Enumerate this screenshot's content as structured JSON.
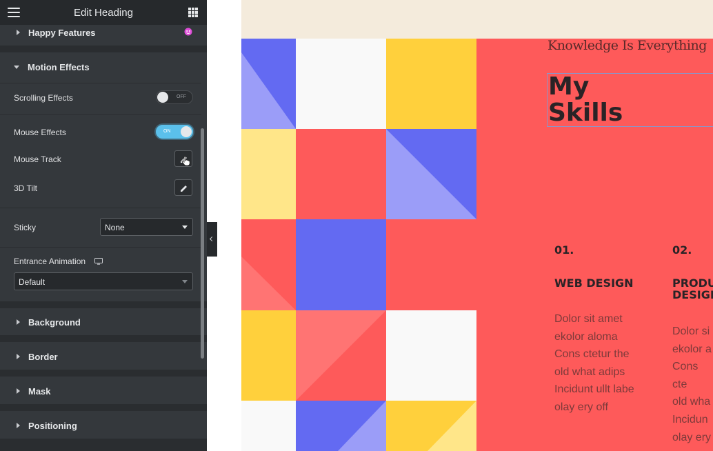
{
  "panel": {
    "title": "Edit Heading",
    "sections": {
      "happy_features": "Happy Features",
      "motion_effects": "Motion Effects",
      "background": "Background",
      "border": "Border",
      "mask": "Mask",
      "positioning": "Positioning"
    },
    "motion": {
      "scrolling_label": "Scrolling Effects",
      "scrolling_state": "OFF",
      "mouse_label": "Mouse Effects",
      "mouse_state": "ON",
      "mouse_track_label": "Mouse Track",
      "tilt_label": "3D Tilt",
      "sticky_label": "Sticky",
      "sticky_value": "None",
      "entrance_label": "Entrance Animation",
      "entrance_value": "Default"
    },
    "icons": {
      "menu": "hamburger-menu-icon",
      "apps": "grid-apps-icon",
      "happy": "happy-addons-icon",
      "edit": "pencil-edit-icon",
      "responsive": "desktop-monitor-icon",
      "cursor": "hand-pointer-icon",
      "collapse": "chevron-left-icon"
    }
  },
  "preview": {
    "kicker": "Knowledge Is Everything",
    "title_line1": "My",
    "title_line2": "Skills",
    "skills": [
      {
        "num": "01.",
        "name_line1": "WEB DESIGN",
        "name_line2": "",
        "lines": [
          "Dolor sit amet",
          "ekolor aloma",
          "Cons ctetur the",
          "old what adips",
          "Incidunt ullt labe",
          "olay ery off"
        ]
      },
      {
        "num": "02.",
        "name_line1": "PRODU",
        "name_line2": "DESIGN",
        "lines": [
          "Dolor si",
          "ekolor a",
          "Cons cte",
          "old wha",
          "Incidun",
          "olay ery"
        ]
      }
    ]
  },
  "colors": {
    "panel_bg": "#34383c",
    "topbar_bg": "#26292c",
    "toggle_on": "#5bc0eb",
    "red": "#fe5a5a",
    "blue": "#636af2",
    "light_blue": "#9b9df8",
    "yellow": "#ffd03c",
    "light_yellow": "#ffe689",
    "pink": "#ff7473",
    "off_white": "#f9f9f9",
    "beige": "#f4ebdc"
  }
}
